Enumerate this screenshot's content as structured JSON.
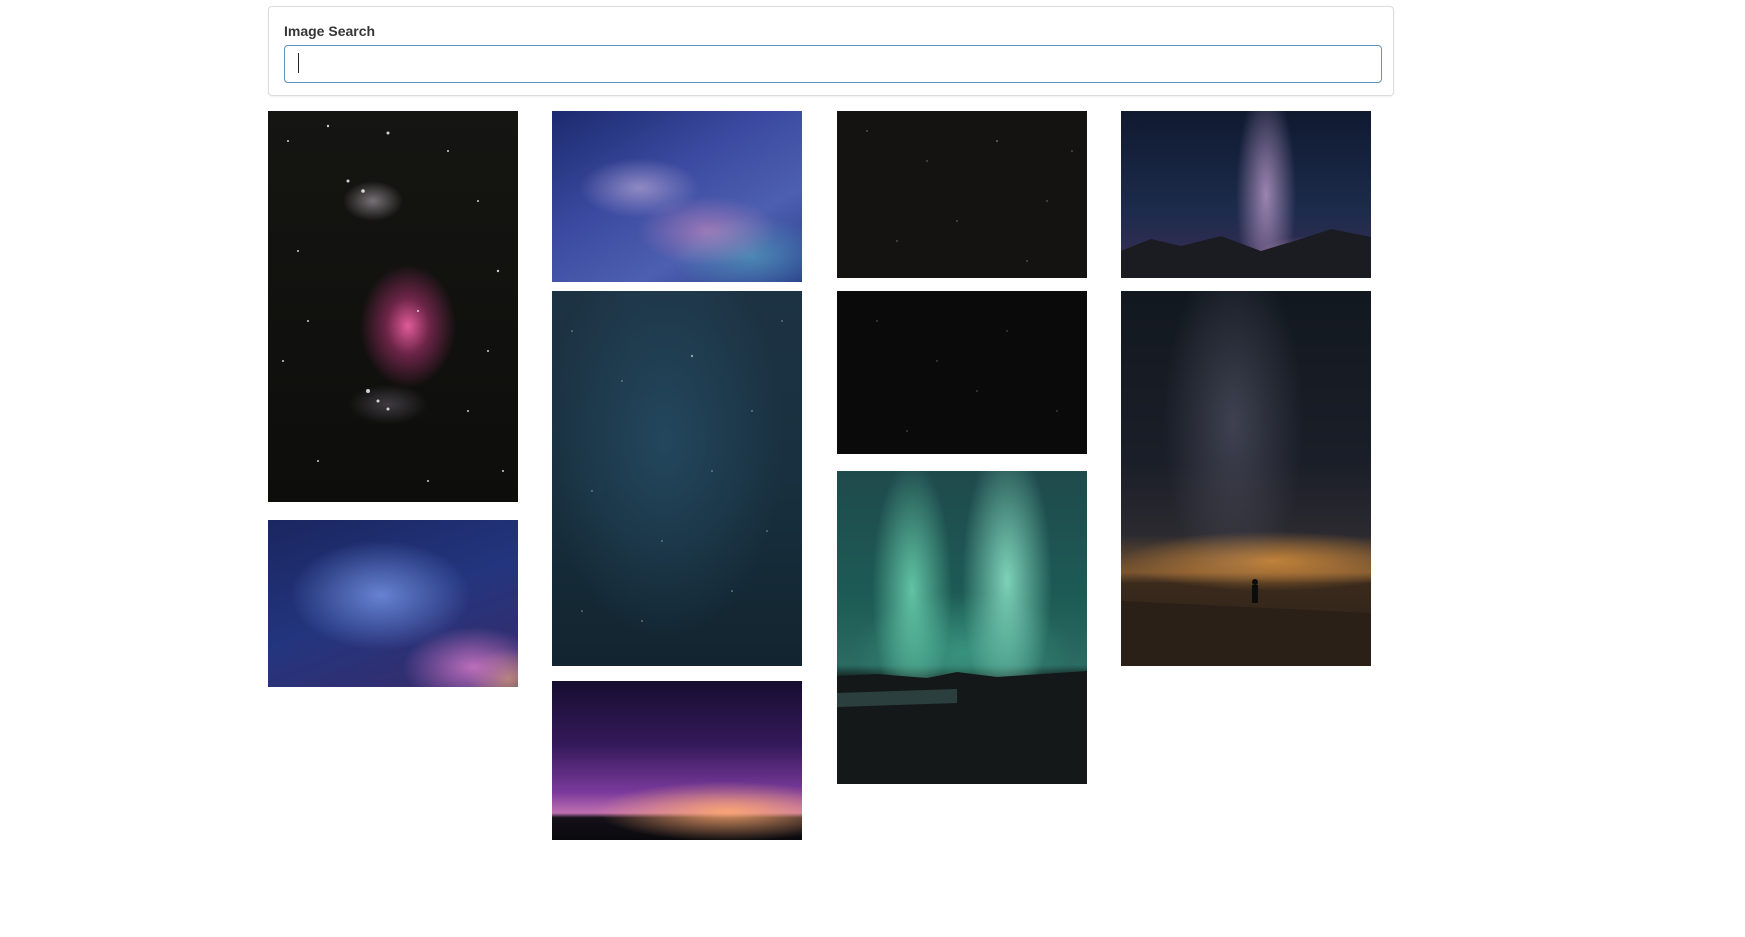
{
  "search": {
    "label": "Image Search",
    "value": "",
    "placeholder": ""
  },
  "gallery": {
    "images": [
      {
        "id": "orion-nebula",
        "icon": "nebula-image"
      },
      {
        "id": "blue-milky-way",
        "icon": "milky-way-image"
      },
      {
        "id": "dark-star-field-1",
        "icon": "star-field-image"
      },
      {
        "id": "milky-way-mountains",
        "icon": "milky-way-image"
      },
      {
        "id": "teal-star-field",
        "icon": "star-field-image"
      },
      {
        "id": "dark-star-field-2",
        "icon": "star-field-image"
      },
      {
        "id": "milky-way-person",
        "icon": "milky-way-image"
      },
      {
        "id": "blue-purple-galaxy",
        "icon": "galaxy-image"
      },
      {
        "id": "aurora-borealis",
        "icon": "aurora-image"
      },
      {
        "id": "purple-horizon",
        "icon": "night-sky-image"
      }
    ]
  },
  "colors": {
    "input_border": "#5c96b8",
    "label": "#363636",
    "card_border": "#dcdcdc"
  }
}
